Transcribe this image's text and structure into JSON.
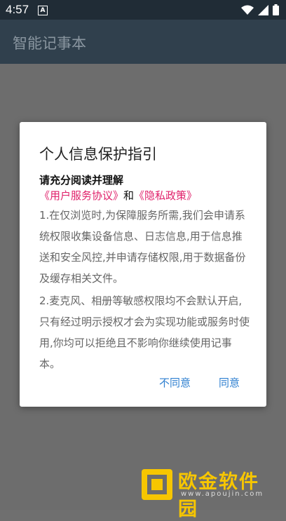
{
  "status_bar": {
    "time": "4:57",
    "notification_letter": "A"
  },
  "app_bar": {
    "title": "智能记事本"
  },
  "dialog": {
    "title": "个人信息保护指引",
    "subtitle": "请充分阅读并理解",
    "link_user_agreement": "《用户服务协议》",
    "link_and": "和",
    "link_privacy_policy": "《隐私政策》",
    "paragraph1": "1.在仅浏览时,为保障服务所需,我们会申请系统权限收集设备信息、日志信息,用于信息推送和安全风控,并申请存储权限,用于数据备份及缓存相关文件。",
    "paragraph2": "2.麦克风、相册等敏感权限均不会默认开启,只有经过明示授权才会为实现功能或服务时使用,你均可以拒绝且不影响你继续使用记事本。",
    "disagree_label": "不同意",
    "agree_label": "同意"
  },
  "watermark": {
    "text": "欧金软件园",
    "url": "www.apoujin.com"
  },
  "colors": {
    "link": "#e0206a",
    "button": "#2e7fd0",
    "app_bar": "#30404d"
  }
}
